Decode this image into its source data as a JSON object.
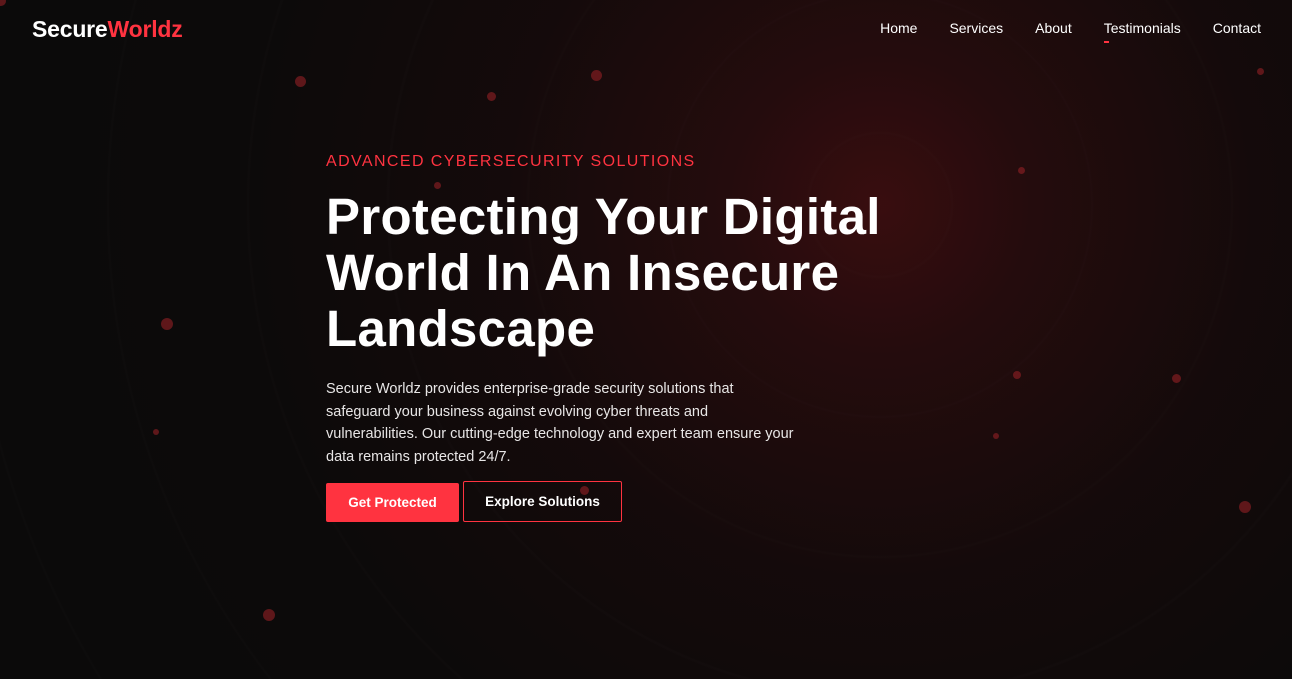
{
  "brand": {
    "name_part1": "Secure",
    "name_part2": "Worldz",
    "accent_color": "#ff3340"
  },
  "nav": {
    "items": [
      {
        "label": "Home"
      },
      {
        "label": "Services"
      },
      {
        "label": "About"
      },
      {
        "label": "Testimonials",
        "active": true
      },
      {
        "label": "Contact"
      }
    ]
  },
  "hero": {
    "eyebrow": "ADVANCED CYBERSECURITY SOLUTIONS",
    "headline": "Protecting Your Digital World In An Insecure Landscape",
    "description": "Secure Worldz provides enterprise-grade security solutions that safeguard your business against evolving cyber threats and vulnerabilities. Our cutting-edge technology and expert team ensure your data remains protected 24/7.",
    "primary_button": "Get Protected",
    "secondary_button": "Explore Solutions"
  },
  "theme": {
    "background": "#0b0a0a",
    "glow": "#7a1216"
  }
}
